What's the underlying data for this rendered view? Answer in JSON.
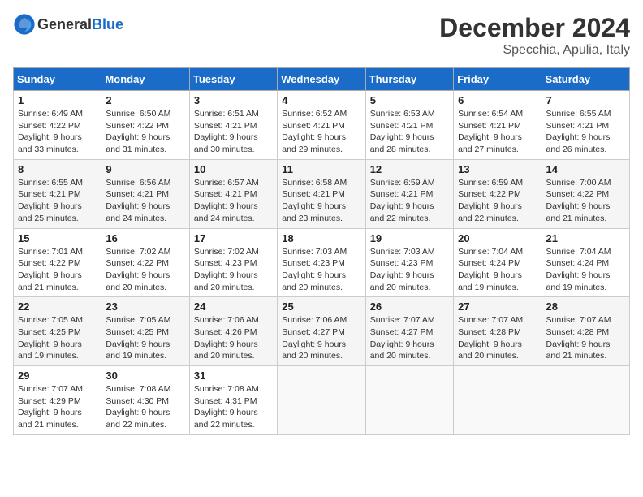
{
  "header": {
    "logo_general": "General",
    "logo_blue": "Blue",
    "month": "December 2024",
    "location": "Specchia, Apulia, Italy"
  },
  "weekdays": [
    "Sunday",
    "Monday",
    "Tuesday",
    "Wednesday",
    "Thursday",
    "Friday",
    "Saturday"
  ],
  "weeks": [
    [
      {
        "day": "1",
        "sunrise": "6:49 AM",
        "sunset": "4:22 PM",
        "daylight": "9 hours and 33 minutes."
      },
      {
        "day": "2",
        "sunrise": "6:50 AM",
        "sunset": "4:22 PM",
        "daylight": "9 hours and 31 minutes."
      },
      {
        "day": "3",
        "sunrise": "6:51 AM",
        "sunset": "4:21 PM",
        "daylight": "9 hours and 30 minutes."
      },
      {
        "day": "4",
        "sunrise": "6:52 AM",
        "sunset": "4:21 PM",
        "daylight": "9 hours and 29 minutes."
      },
      {
        "day": "5",
        "sunrise": "6:53 AM",
        "sunset": "4:21 PM",
        "daylight": "9 hours and 28 minutes."
      },
      {
        "day": "6",
        "sunrise": "6:54 AM",
        "sunset": "4:21 PM",
        "daylight": "9 hours and 27 minutes."
      },
      {
        "day": "7",
        "sunrise": "6:55 AM",
        "sunset": "4:21 PM",
        "daylight": "9 hours and 26 minutes."
      }
    ],
    [
      {
        "day": "8",
        "sunrise": "6:55 AM",
        "sunset": "4:21 PM",
        "daylight": "9 hours and 25 minutes."
      },
      {
        "day": "9",
        "sunrise": "6:56 AM",
        "sunset": "4:21 PM",
        "daylight": "9 hours and 24 minutes."
      },
      {
        "day": "10",
        "sunrise": "6:57 AM",
        "sunset": "4:21 PM",
        "daylight": "9 hours and 24 minutes."
      },
      {
        "day": "11",
        "sunrise": "6:58 AM",
        "sunset": "4:21 PM",
        "daylight": "9 hours and 23 minutes."
      },
      {
        "day": "12",
        "sunrise": "6:59 AM",
        "sunset": "4:21 PM",
        "daylight": "9 hours and 22 minutes."
      },
      {
        "day": "13",
        "sunrise": "6:59 AM",
        "sunset": "4:22 PM",
        "daylight": "9 hours and 22 minutes."
      },
      {
        "day": "14",
        "sunrise": "7:00 AM",
        "sunset": "4:22 PM",
        "daylight": "9 hours and 21 minutes."
      }
    ],
    [
      {
        "day": "15",
        "sunrise": "7:01 AM",
        "sunset": "4:22 PM",
        "daylight": "9 hours and 21 minutes."
      },
      {
        "day": "16",
        "sunrise": "7:02 AM",
        "sunset": "4:22 PM",
        "daylight": "9 hours and 20 minutes."
      },
      {
        "day": "17",
        "sunrise": "7:02 AM",
        "sunset": "4:23 PM",
        "daylight": "9 hours and 20 minutes."
      },
      {
        "day": "18",
        "sunrise": "7:03 AM",
        "sunset": "4:23 PM",
        "daylight": "9 hours and 20 minutes."
      },
      {
        "day": "19",
        "sunrise": "7:03 AM",
        "sunset": "4:23 PM",
        "daylight": "9 hours and 20 minutes."
      },
      {
        "day": "20",
        "sunrise": "7:04 AM",
        "sunset": "4:24 PM",
        "daylight": "9 hours and 19 minutes."
      },
      {
        "day": "21",
        "sunrise": "7:04 AM",
        "sunset": "4:24 PM",
        "daylight": "9 hours and 19 minutes."
      }
    ],
    [
      {
        "day": "22",
        "sunrise": "7:05 AM",
        "sunset": "4:25 PM",
        "daylight": "9 hours and 19 minutes."
      },
      {
        "day": "23",
        "sunrise": "7:05 AM",
        "sunset": "4:25 PM",
        "daylight": "9 hours and 19 minutes."
      },
      {
        "day": "24",
        "sunrise": "7:06 AM",
        "sunset": "4:26 PM",
        "daylight": "9 hours and 20 minutes."
      },
      {
        "day": "25",
        "sunrise": "7:06 AM",
        "sunset": "4:27 PM",
        "daylight": "9 hours and 20 minutes."
      },
      {
        "day": "26",
        "sunrise": "7:07 AM",
        "sunset": "4:27 PM",
        "daylight": "9 hours and 20 minutes."
      },
      {
        "day": "27",
        "sunrise": "7:07 AM",
        "sunset": "4:28 PM",
        "daylight": "9 hours and 20 minutes."
      },
      {
        "day": "28",
        "sunrise": "7:07 AM",
        "sunset": "4:28 PM",
        "daylight": "9 hours and 21 minutes."
      }
    ],
    [
      {
        "day": "29",
        "sunrise": "7:07 AM",
        "sunset": "4:29 PM",
        "daylight": "9 hours and 21 minutes."
      },
      {
        "day": "30",
        "sunrise": "7:08 AM",
        "sunset": "4:30 PM",
        "daylight": "9 hours and 22 minutes."
      },
      {
        "day": "31",
        "sunrise": "7:08 AM",
        "sunset": "4:31 PM",
        "daylight": "9 hours and 22 minutes."
      },
      null,
      null,
      null,
      null
    ]
  ]
}
